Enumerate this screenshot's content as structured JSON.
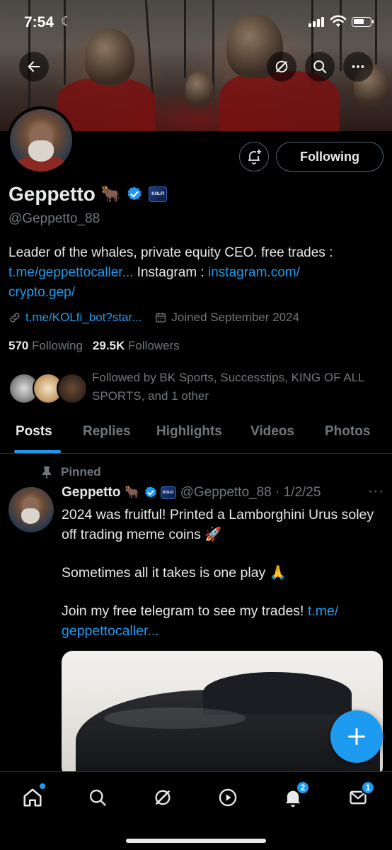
{
  "status_bar": {
    "time": "7:54"
  },
  "profile": {
    "name": "Geppetto",
    "name_emoji": "🐂",
    "affiliate_badge": "KOLFI",
    "handle": "@Geppetto_88",
    "follow_button": "Following",
    "bio_text": "Leader of the whales, private equity CEO. free trades : ",
    "bio_link_1": "t.me/geppettocaller...",
    "bio_text_2": " Instagram : ",
    "bio_link_2a": "instagram.com/",
    "bio_link_2b": "crypto.gep/",
    "website": "t.me/KOLfi_bot?star...",
    "joined": "Joined September 2024",
    "following_count": "570",
    "following_label": "Following",
    "followers_count": "29.5K",
    "followers_label": "Followers",
    "followed_by": "Followed by BK Sports, Successtips, KING OF ALL SPORTS, and 1 other"
  },
  "tabs": [
    "Posts",
    "Replies",
    "Highlights",
    "Videos",
    "Photos"
  ],
  "active_tab": "Posts",
  "post": {
    "pinned_label": "Pinned",
    "author": "Geppetto",
    "author_emoji": "🐂",
    "handle_date": "@Geppetto_88 · 1/2/25",
    "more": "···",
    "line_1": "2024 was fruitful! Printed a Lamborghini Urus soley off trading meme coins 🚀",
    "line_2": "Sometimes all it takes is one play 🙏",
    "line_3": "Join my free telegram to see my trades! ",
    "line_3_link": "t.me/ geppettocaller..."
  },
  "bottom_nav": {
    "notifications_badge": "2",
    "messages_badge": "1"
  },
  "colors": {
    "accent": "#1d9bf0",
    "background": "#000000",
    "muted_text": "#71767b"
  }
}
